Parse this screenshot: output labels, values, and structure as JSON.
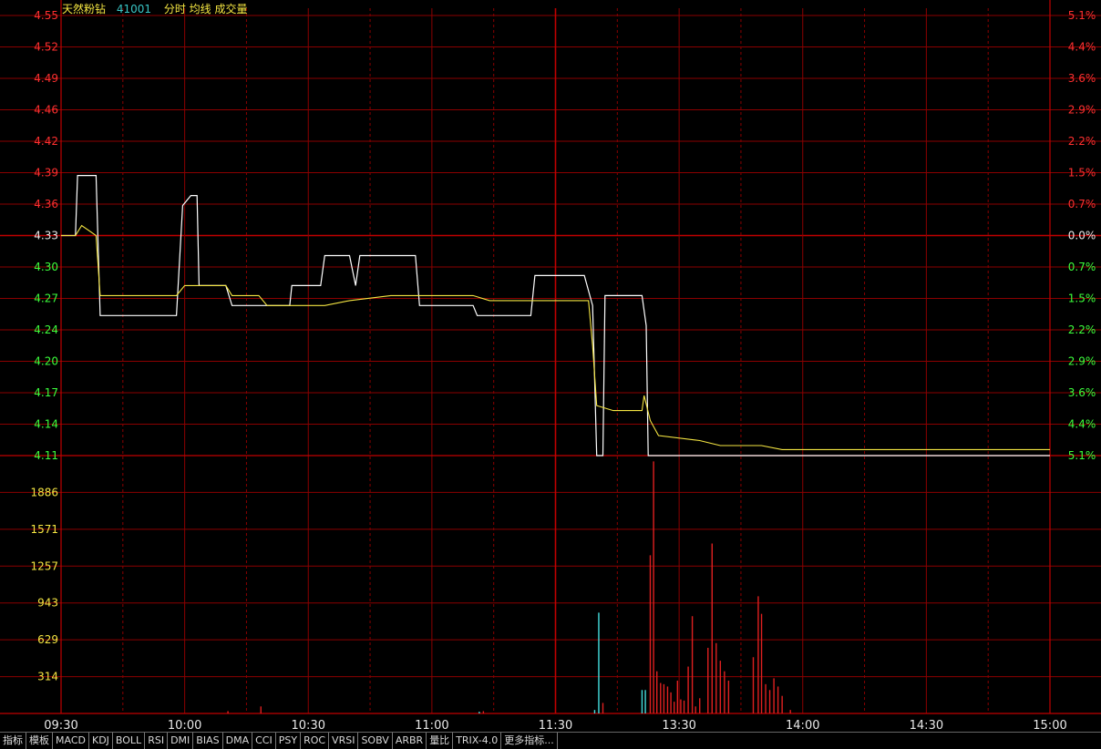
{
  "header": {
    "name": "天然粉钻",
    "code": "41001",
    "mode": "分时 均线 成交量"
  },
  "price_axis": {
    "labels": [
      "4.55",
      "4.52",
      "4.49",
      "4.46",
      "4.42",
      "4.39",
      "4.36",
      "4.33",
      "4.30",
      "4.27",
      "4.24",
      "4.20",
      "4.17",
      "4.14",
      "4.11"
    ],
    "pct_labels": [
      "5.1%",
      "4.4%",
      "3.6%",
      "2.9%",
      "2.2%",
      "1.5%",
      "0.7%",
      "0.0%",
      "0.7%",
      "1.5%",
      "2.2%",
      "2.9%",
      "3.6%",
      "4.4%",
      "5.1%"
    ],
    "prev_close": 4.33
  },
  "volume_axis": {
    "labels": [
      "1886",
      "1571",
      "1257",
      "943",
      "629",
      "314"
    ]
  },
  "time_axis": {
    "labels": [
      "09:30",
      "10:00",
      "10:30",
      "11:00",
      "11:30",
      "13:30",
      "14:00",
      "14:30",
      "15:00"
    ]
  },
  "colors": {
    "up": "#ff3030",
    "down": "#3cff3c",
    "flat": "#e8e8e8",
    "grid": "#8b0000",
    "price_line": "#ffffff",
    "avg_line": "#f5e642",
    "volume_bar": "#e02020",
    "volume_bar_down": "#44e0e0",
    "vol_label": "#f5e642"
  },
  "chart_data": {
    "type": "line",
    "x_range": [
      0,
      240
    ],
    "ylim": [
      4.11,
      4.55
    ],
    "series": [
      {
        "kind": "price",
        "points": [
          [
            0,
            4.33
          ],
          [
            3.5,
            4.33
          ],
          [
            4,
            4.39
          ],
          [
            8.5,
            4.39
          ],
          [
            9.5,
            4.25
          ],
          [
            28,
            4.25
          ],
          [
            29.5,
            4.36
          ],
          [
            31.5,
            4.37
          ],
          [
            33,
            4.37
          ],
          [
            33.5,
            4.28
          ],
          [
            40,
            4.28
          ],
          [
            41.5,
            4.26
          ],
          [
            55.5,
            4.26
          ],
          [
            56,
            4.28
          ],
          [
            63,
            4.28
          ],
          [
            64,
            4.31
          ],
          [
            70,
            4.31
          ],
          [
            71.5,
            4.28
          ],
          [
            72.5,
            4.31
          ],
          [
            86,
            4.31
          ],
          [
            87,
            4.26
          ],
          [
            100,
            4.26
          ],
          [
            101,
            4.25
          ],
          [
            114,
            4.25
          ],
          [
            115,
            4.29
          ],
          [
            127,
            4.29
          ],
          [
            129,
            4.26
          ],
          [
            130,
            4.11
          ],
          [
            131.5,
            4.11
          ],
          [
            132,
            4.27
          ],
          [
            141,
            4.27
          ],
          [
            142,
            4.24
          ],
          [
            142.5,
            4.11
          ],
          [
            240,
            4.11
          ]
        ]
      },
      {
        "kind": "avg",
        "points": [
          [
            0,
            4.33
          ],
          [
            3.5,
            4.33
          ],
          [
            5,
            4.34
          ],
          [
            8.5,
            4.33
          ],
          [
            9.5,
            4.27
          ],
          [
            28,
            4.27
          ],
          [
            30,
            4.28
          ],
          [
            40,
            4.28
          ],
          [
            41.5,
            4.27
          ],
          [
            48,
            4.27
          ],
          [
            50,
            4.26
          ],
          [
            64,
            4.26
          ],
          [
            70,
            4.265
          ],
          [
            80,
            4.27
          ],
          [
            100,
            4.27
          ],
          [
            104,
            4.265
          ],
          [
            110,
            4.265
          ],
          [
            114,
            4.265
          ],
          [
            128,
            4.265
          ],
          [
            129,
            4.22
          ],
          [
            130,
            4.16
          ],
          [
            134,
            4.155
          ],
          [
            141,
            4.155
          ],
          [
            141.5,
            4.17
          ],
          [
            143,
            4.145
          ],
          [
            145,
            4.13
          ],
          [
            155,
            4.125
          ],
          [
            160,
            4.12
          ],
          [
            170,
            4.12
          ],
          [
            175,
            4.116
          ],
          [
            200,
            4.116
          ],
          [
            240,
            4.116
          ]
        ]
      }
    ],
    "volume": {
      "ylim": [
        0,
        2200
      ],
      "bars": [
        {
          "x": 40.5,
          "v": 20,
          "c": "up"
        },
        {
          "x": 48.5,
          "v": 60,
          "c": "up"
        },
        {
          "x": 101.5,
          "v": 15,
          "c": "down"
        },
        {
          "x": 102.5,
          "v": 20,
          "c": "up"
        },
        {
          "x": 129.5,
          "v": 30,
          "c": "down"
        },
        {
          "x": 130.5,
          "v": 860,
          "c": "down"
        },
        {
          "x": 131.5,
          "v": 90,
          "c": "up"
        },
        {
          "x": 141,
          "v": 200,
          "c": "down"
        },
        {
          "x": 141.8,
          "v": 200,
          "c": "down"
        },
        {
          "x": 143,
          "v": 1350,
          "c": "up"
        },
        {
          "x": 143.8,
          "v": 2150,
          "c": "up"
        },
        {
          "x": 144.6,
          "v": 360,
          "c": "up"
        },
        {
          "x": 145.5,
          "v": 260,
          "c": "up"
        },
        {
          "x": 146.3,
          "v": 250,
          "c": "up"
        },
        {
          "x": 147.2,
          "v": 230,
          "c": "up"
        },
        {
          "x": 148,
          "v": 180,
          "c": "up"
        },
        {
          "x": 148.8,
          "v": 100,
          "c": "up"
        },
        {
          "x": 149.6,
          "v": 280,
          "c": "up"
        },
        {
          "x": 150.4,
          "v": 120,
          "c": "up"
        },
        {
          "x": 151.2,
          "v": 110,
          "c": "up"
        },
        {
          "x": 152.2,
          "v": 400,
          "c": "up"
        },
        {
          "x": 153.2,
          "v": 830,
          "c": "up"
        },
        {
          "x": 154,
          "v": 60,
          "c": "up"
        },
        {
          "x": 155,
          "v": 130,
          "c": "up"
        },
        {
          "x": 157,
          "v": 560,
          "c": "up"
        },
        {
          "x": 158,
          "v": 1450,
          "c": "up"
        },
        {
          "x": 159,
          "v": 600,
          "c": "up"
        },
        {
          "x": 160,
          "v": 450,
          "c": "up"
        },
        {
          "x": 161,
          "v": 360,
          "c": "up"
        },
        {
          "x": 162,
          "v": 280,
          "c": "up"
        },
        {
          "x": 168,
          "v": 480,
          "c": "up"
        },
        {
          "x": 169.2,
          "v": 1000,
          "c": "up"
        },
        {
          "x": 170,
          "v": 850,
          "c": "up"
        },
        {
          "x": 171,
          "v": 250,
          "c": "up"
        },
        {
          "x": 172,
          "v": 200,
          "c": "up"
        },
        {
          "x": 173,
          "v": 300,
          "c": "up"
        },
        {
          "x": 174,
          "v": 230,
          "c": "up"
        },
        {
          "x": 175,
          "v": 150,
          "c": "up"
        },
        {
          "x": 177,
          "v": 30,
          "c": "up"
        }
      ]
    }
  },
  "tabs": [
    "指标",
    "模板",
    "MACD",
    "KDJ",
    "BOLL",
    "RSI",
    "DMI",
    "BIAS",
    "DMA",
    "CCI",
    "PSY",
    "ROC",
    "VRSI",
    "SOBV",
    "ARBR",
    "量比",
    "TRIX-4.0",
    "更多指标..."
  ]
}
